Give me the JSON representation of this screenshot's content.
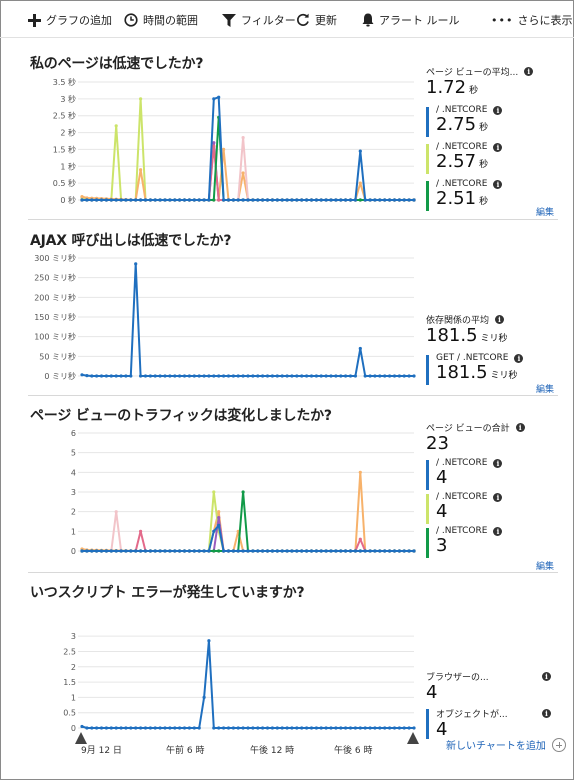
{
  "toolbar": {
    "add_chart": "グラフの追加",
    "time_range": "時間の範囲",
    "filter": "フィルター",
    "refresh": "更新",
    "alert_rules": "アラート ルール",
    "more": "さらに表示"
  },
  "colors": {
    "blue": "#1f6fbf",
    "lime": "#cce46a",
    "green": "#119a48",
    "orange": "#f7b26b",
    "pink": "#e36a8a",
    "lightpink": "#f2c4c9",
    "purple": "#9a5bbd",
    "grid": "#e6e6e6"
  },
  "sections": [
    {
      "title": "私のページは低速でしたか?",
      "edit": "編集",
      "legend": [
        {
          "label": "ページ ビューの平均...",
          "value": "1.72",
          "unit": "秒",
          "color": ""
        },
        {
          "label": "/ .NETCORE",
          "value": "2.75",
          "unit": "秒",
          "color": "#1f6fbf"
        },
        {
          "label": "/ .NETCORE",
          "value": "2.57",
          "unit": "秒",
          "color": "#cce46a"
        },
        {
          "label": "/ .NETCORE",
          "value": "2.51",
          "unit": "秒",
          "color": "#119a48"
        }
      ]
    },
    {
      "title": "AJAX 呼び出しは低速でしたか?",
      "edit": "編集",
      "legend": [
        {
          "label": "依存関係の平均",
          "value": "181.5",
          "unit": "ミリ秒",
          "color": ""
        },
        {
          "label": "GET  / .NETCORE",
          "value": "181.5",
          "unit": "ミリ秒",
          "color": "#1f6fbf"
        }
      ]
    },
    {
      "title": "ページ ビューのトラフィックは変化しましたか?",
      "edit": "編集",
      "legend": [
        {
          "label": "ページ ビューの合計",
          "value": "23",
          "unit": "",
          "color": ""
        },
        {
          "label": "/ .NETCORE",
          "value": "4",
          "unit": "",
          "color": "#1f6fbf"
        },
        {
          "label": "/ .NETCORE",
          "value": "4",
          "unit": "",
          "color": "#cce46a"
        },
        {
          "label": "/ .NETCORE",
          "value": "3",
          "unit": "",
          "color": "#119a48"
        }
      ]
    },
    {
      "title": "いつスクリプト エラーが発生していますか?",
      "legend": [
        {
          "label": "ブラウザーの...",
          "value": "4",
          "unit": "",
          "color": ""
        },
        {
          "label": "オブジェクトが...",
          "value": "4",
          "unit": "",
          "color": "#1f6fbf"
        }
      ]
    }
  ],
  "x_ticks": [
    "9月 12 日",
    "午前 6 時",
    "午後 12 時",
    "午後 6 時"
  ],
  "add_chart_link": "新しいチャートを追加",
  "chart_data": [
    {
      "type": "line",
      "title": "私のページは低速でしたか?",
      "y_tick_labels": [
        "3.5 秒",
        "3 秒",
        "2.5 秒",
        "2 秒",
        "1.5 秒",
        "1 秒",
        "0.5 秒",
        "0 秒"
      ],
      "ylim": [
        0,
        3.5
      ],
      "x": [
        0,
        1,
        2,
        3,
        4,
        5,
        6,
        7,
        8,
        9,
        10,
        11,
        12,
        13,
        14,
        15,
        16,
        17,
        18,
        19,
        20,
        21,
        22,
        23,
        24,
        25,
        26,
        27,
        28,
        29,
        30,
        31,
        32,
        33,
        34,
        35,
        36,
        37,
        38,
        39,
        40,
        41,
        42,
        43,
        44,
        45,
        46,
        47,
        48,
        49,
        50,
        51,
        52,
        53,
        54,
        55,
        56,
        57,
        58,
        59,
        60,
        61,
        62,
        63,
        64,
        65,
        66,
        67,
        68
      ],
      "series": [
        {
          "color": "#cce46a",
          "points": [
            [
              0,
              0.08
            ],
            [
              1,
              0.04
            ],
            [
              6,
              0
            ],
            [
              7,
              2.2
            ],
            [
              8,
              0
            ],
            [
              11,
              0
            ],
            [
              12,
              3.0
            ],
            [
              13,
              0
            ],
            [
              68,
              0
            ]
          ]
        },
        {
          "color": "#f7b26b",
          "points": [
            [
              0,
              0.1
            ],
            [
              1,
              0.06
            ],
            [
              11,
              0
            ],
            [
              12,
              0.9
            ],
            [
              13,
              0
            ],
            [
              28,
              0
            ],
            [
              29,
              1.5
            ],
            [
              30,
              0
            ],
            [
              32,
              0
            ],
            [
              33,
              0.8
            ],
            [
              34,
              0
            ],
            [
              56,
              0
            ],
            [
              57,
              0.5
            ],
            [
              58,
              0
            ],
            [
              68,
              0
            ]
          ]
        },
        {
          "color": "#f2c4c9",
          "points": [
            [
              0,
              0
            ],
            [
              32,
              0
            ],
            [
              33,
              1.85
            ],
            [
              34,
              0
            ],
            [
              68,
              0
            ]
          ]
        },
        {
          "color": "#9a5bbd",
          "points": [
            [
              0,
              0
            ],
            [
              26,
              0
            ],
            [
              27,
              1.7
            ],
            [
              28,
              0
            ],
            [
              68,
              0
            ]
          ]
        },
        {
          "color": "#e36a8a",
          "points": [
            [
              0,
              0
            ],
            [
              26,
              0
            ],
            [
              27,
              1.6
            ],
            [
              28,
              0
            ],
            [
              68,
              0
            ]
          ]
        },
        {
          "color": "#119a48",
          "points": [
            [
              0,
              0
            ],
            [
              27,
              0
            ],
            [
              28,
              2.45
            ],
            [
              29,
              0
            ],
            [
              68,
              0
            ]
          ]
        },
        {
          "color": "#1f6fbf",
          "points": [
            [
              0,
              0
            ],
            [
              26,
              0
            ],
            [
              27,
              3.0
            ],
            [
              28,
              3.05
            ],
            [
              29,
              0
            ],
            [
              56,
              0
            ],
            [
              57,
              1.45
            ],
            [
              58,
              0
            ],
            [
              68,
              0
            ]
          ]
        }
      ]
    },
    {
      "type": "line",
      "title": "AJAX 呼び出しは低速でしたか?",
      "y_tick_labels": [
        "300 ミリ秒",
        "250 ミリ秒",
        "200 ミリ秒",
        "150 ミリ秒",
        "100 ミリ秒",
        "50 ミリ秒",
        "0 ミリ秒"
      ],
      "ylim": [
        0,
        300
      ],
      "x": [
        0,
        1,
        2,
        3,
        4,
        5,
        6,
        7,
        8,
        9,
        10,
        11,
        12,
        13,
        14,
        15,
        16,
        17,
        18,
        19,
        20,
        21,
        22,
        23,
        24,
        25,
        26,
        27,
        28,
        29,
        30,
        31,
        32,
        33,
        34,
        35,
        36,
        37,
        38,
        39,
        40,
        41,
        42,
        43,
        44,
        45,
        46,
        47,
        48,
        49,
        50,
        51,
        52,
        53,
        54,
        55,
        56,
        57,
        58,
        59,
        60,
        61,
        62,
        63,
        64,
        65,
        66,
        67,
        68
      ],
      "series": [
        {
          "color": "#1f6fbf",
          "points": [
            [
              0,
              3
            ],
            [
              1,
              1
            ],
            [
              2,
              0
            ],
            [
              10,
              0
            ],
            [
              11,
              285
            ],
            [
              12,
              0
            ],
            [
              56,
              0
            ],
            [
              57,
              70
            ],
            [
              58,
              0
            ],
            [
              68,
              0
            ]
          ]
        }
      ]
    },
    {
      "type": "line",
      "title": "ページ ビューのトラフィックは変化しましたか?",
      "y_tick_labels": [
        "6",
        "5",
        "4",
        "3",
        "2",
        "1",
        "0"
      ],
      "ylim": [
        0,
        6
      ],
      "x": [
        0,
        1,
        2,
        3,
        4,
        5,
        6,
        7,
        8,
        9,
        10,
        11,
        12,
        13,
        14,
        15,
        16,
        17,
        18,
        19,
        20,
        21,
        22,
        23,
        24,
        25,
        26,
        27,
        28,
        29,
        30,
        31,
        32,
        33,
        34,
        35,
        36,
        37,
        38,
        39,
        40,
        41,
        42,
        43,
        44,
        45,
        46,
        47,
        48,
        49,
        50,
        51,
        52,
        53,
        54,
        55,
        56,
        57,
        58,
        59,
        60,
        61,
        62,
        63,
        64,
        65,
        66,
        67,
        68
      ],
      "series": [
        {
          "color": "#f7b26b",
          "points": [
            [
              0,
              0.1
            ],
            [
              1,
              0.05
            ],
            [
              12,
              0
            ],
            [
              13,
              0
            ],
            [
              26,
              0
            ],
            [
              27,
              1
            ],
            [
              28,
              2
            ],
            [
              29,
              0
            ],
            [
              31,
              0
            ],
            [
              32,
              1
            ],
            [
              33,
              0
            ],
            [
              56,
              0
            ],
            [
              57,
              4
            ],
            [
              58,
              0
            ],
            [
              68,
              0
            ]
          ]
        },
        {
          "color": "#f2c4c9",
          "points": [
            [
              0,
              0
            ],
            [
              6,
              0
            ],
            [
              7,
              2
            ],
            [
              8,
              0
            ],
            [
              68,
              0
            ]
          ]
        },
        {
          "color": "#e36a8a",
          "points": [
            [
              0,
              0
            ],
            [
              11,
              0
            ],
            [
              12,
              1
            ],
            [
              13,
              0
            ],
            [
              56,
              0
            ],
            [
              57,
              0.6
            ],
            [
              58,
              0
            ],
            [
              68,
              0
            ]
          ]
        },
        {
          "color": "#cce46a",
          "points": [
            [
              0,
              0
            ],
            [
              26,
              0
            ],
            [
              27,
              3
            ],
            [
              28,
              1
            ],
            [
              29,
              0
            ],
            [
              68,
              0
            ]
          ]
        },
        {
          "color": "#9a5bbd",
          "points": [
            [
              0,
              0
            ],
            [
              27,
              0
            ],
            [
              28,
              1.7
            ],
            [
              29,
              0
            ],
            [
              68,
              0
            ]
          ]
        },
        {
          "color": "#119a48",
          "points": [
            [
              0,
              0
            ],
            [
              31,
              0
            ],
            [
              32,
              0
            ],
            [
              33,
              3
            ],
            [
              34,
              0
            ],
            [
              68,
              0
            ]
          ]
        },
        {
          "color": "#1f6fbf",
          "points": [
            [
              0,
              0
            ],
            [
              26,
              0
            ],
            [
              27,
              1
            ],
            [
              28,
              1.3
            ],
            [
              29,
              0
            ],
            [
              68,
              0
            ]
          ]
        }
      ]
    },
    {
      "type": "line",
      "title": "いつスクリプト エラーが発生していますか?",
      "y_tick_labels": [
        "3",
        "2.5",
        "2",
        "1.5",
        "1",
        "0.5",
        "0"
      ],
      "ylim": [
        0,
        3.2
      ],
      "x": [
        0,
        1,
        2,
        3,
        4,
        5,
        6,
        7,
        8,
        9,
        10,
        11,
        12,
        13,
        14,
        15,
        16,
        17,
        18,
        19,
        20,
        21,
        22,
        23,
        24,
        25,
        26,
        27,
        28,
        29,
        30,
        31,
        32,
        33,
        34,
        35,
        36,
        37,
        38,
        39,
        40,
        41,
        42,
        43,
        44,
        45,
        46,
        47,
        48,
        49,
        50,
        51,
        52,
        53,
        54,
        55,
        56,
        57,
        58,
        59,
        60,
        61,
        62,
        63,
        64,
        65,
        66,
        67,
        68
      ],
      "series": [
        {
          "color": "#1f6fbf",
          "points": [
            [
              0,
              0.05
            ],
            [
              1,
              0
            ],
            [
              24,
              0
            ],
            [
              25,
              1
            ],
            [
              26,
              2.85
            ],
            [
              27,
              0
            ],
            [
              68,
              0
            ]
          ]
        }
      ]
    }
  ]
}
